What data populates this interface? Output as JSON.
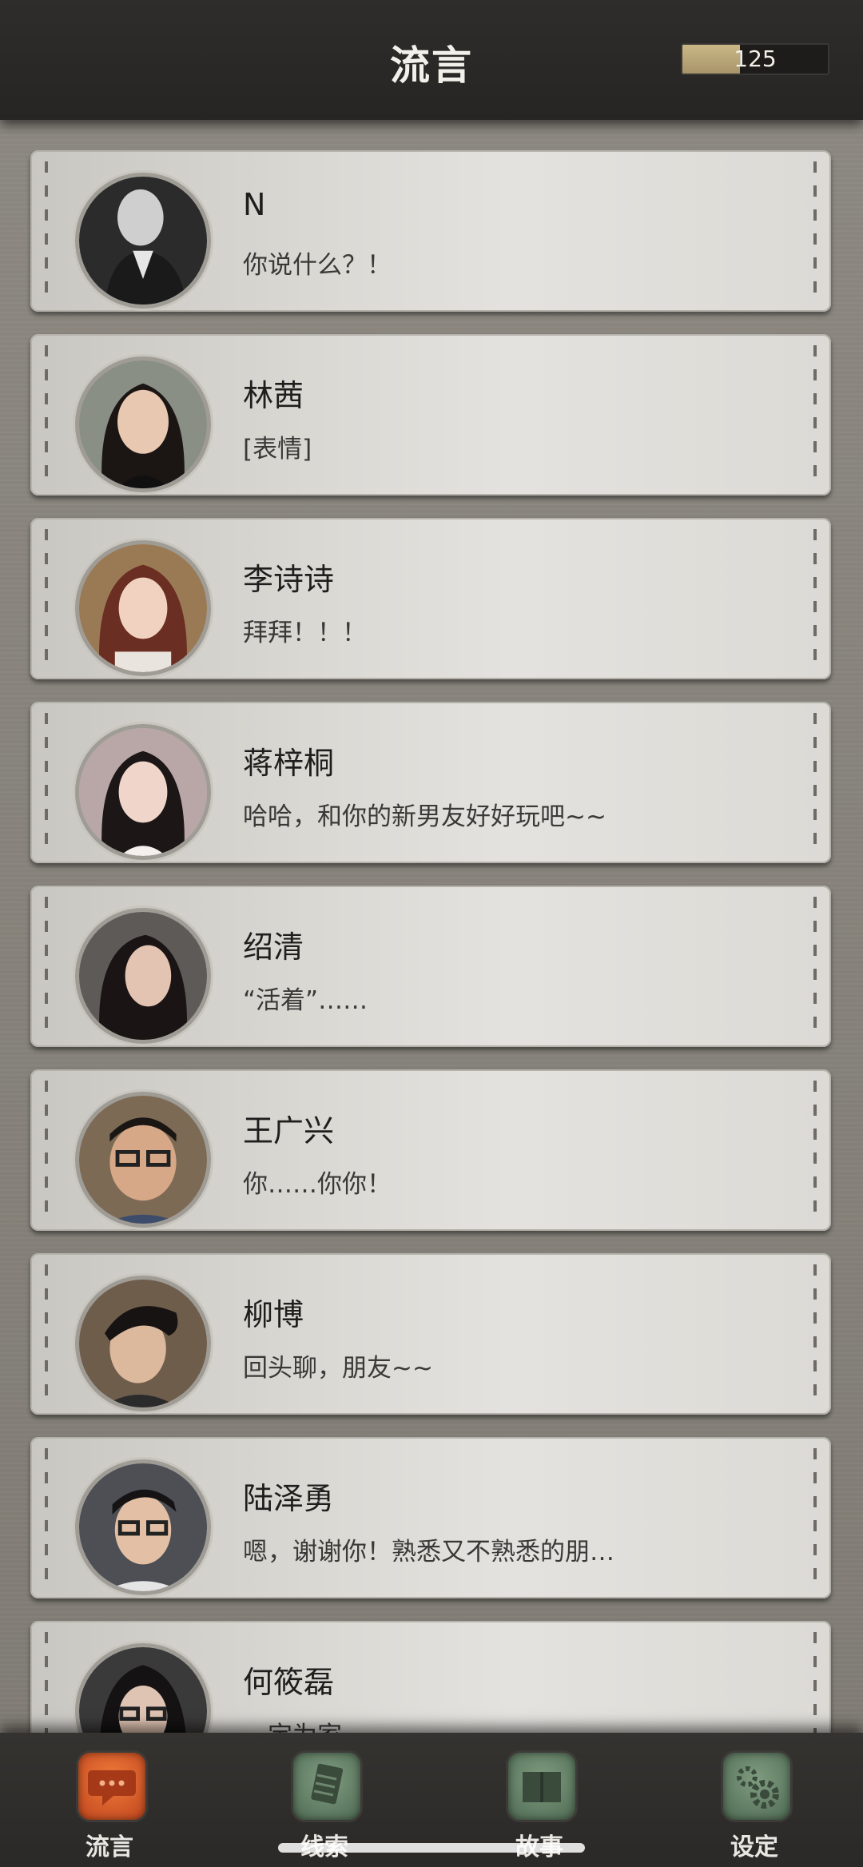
{
  "header": {
    "title": "流言",
    "currency": "125"
  },
  "contacts": [
    {
      "name": "N",
      "message": "你说什么？！"
    },
    {
      "name": "林茜",
      "message": "[表情]"
    },
    {
      "name": "李诗诗",
      "message": "拜拜！！！"
    },
    {
      "name": "蒋梓桐",
      "message": "哈哈，和你的新男友好好玩吧~~"
    },
    {
      "name": "绍清",
      "message": "“活着”……"
    },
    {
      "name": "王广兴",
      "message": "你……你你！"
    },
    {
      "name": "柳博",
      "message": "回头聊，朋友~~"
    },
    {
      "name": "陆泽勇",
      "message": "嗯，谢谢你！熟悉又不熟悉的朋…"
    },
    {
      "name": "何筱磊",
      "message": "一定为家"
    }
  ],
  "nav": [
    {
      "label": "流言",
      "icon": "chat-bubble-icon",
      "active": true
    },
    {
      "label": "线索",
      "icon": "notes-icon",
      "active": false
    },
    {
      "label": "故事",
      "icon": "book-icon",
      "active": false
    },
    {
      "label": "设定",
      "icon": "settings-gear-icon",
      "active": false
    }
  ],
  "colors": {
    "active_tab": "#d9582b",
    "inactive_tab": "#5f7d63",
    "card": "#dcdad5"
  }
}
